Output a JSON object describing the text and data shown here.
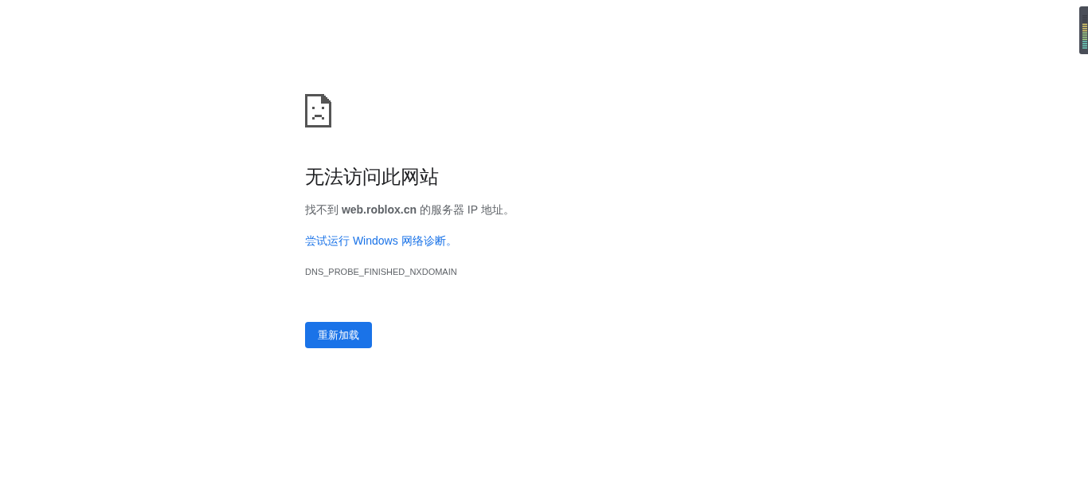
{
  "error_page": {
    "title": "无法访问此网站",
    "message": "找不到 **web.roblox.cn** 的服务器 IP 地址。",
    "link": "尝试运行 Windows 网络诊断。",
    "error_code": "DNS_PROBE_FINISHED_NXDOMAIN",
    "button": "重新加载"
  }
}
